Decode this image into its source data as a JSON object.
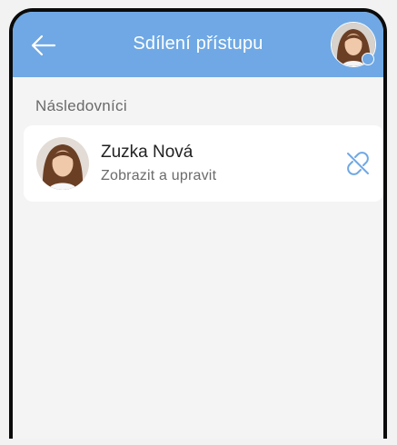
{
  "header": {
    "title": "Sdílení přístupu",
    "back_icon": "arrow-left-icon",
    "account_icon": "user-avatar"
  },
  "section": {
    "label": "Následovníci"
  },
  "followers": [
    {
      "name": "Zuzka Nová",
      "subtitle": "Zobrazit a upravit",
      "action_icon": "unlink-icon"
    }
  ],
  "colors": {
    "accent": "#6fa8e4",
    "background": "#f4f4f4",
    "card": "#ffffff"
  }
}
